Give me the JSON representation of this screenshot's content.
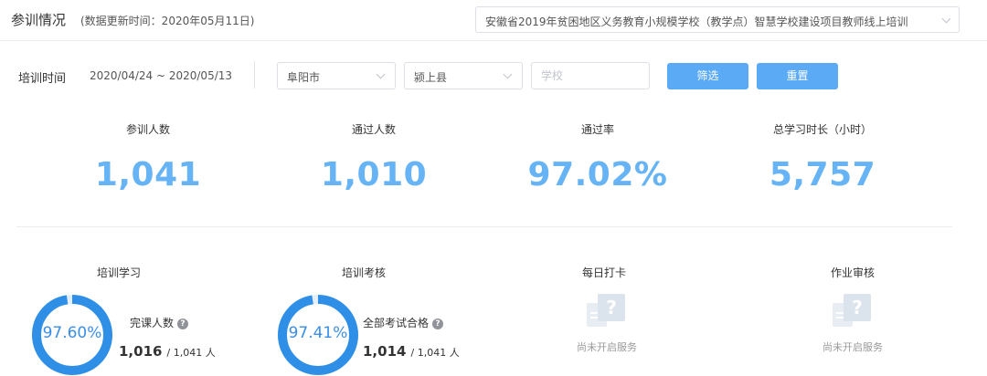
{
  "header": {
    "title": "参训情况",
    "update_info": "(数据更新时间：2020年05月11日)",
    "project": "安徽省2019年贫困地区义务教育小规模学校（教学点）智慧学校建设项目教师线上培训"
  },
  "filters": {
    "time_label": "培训时间",
    "date_range": "2020/04/24 ~ 2020/05/13",
    "city": "阜阳市",
    "county": "颍上县",
    "school_placeholder": "学校",
    "filter_button": "筛选",
    "reset_button": "重置"
  },
  "stats": [
    {
      "label": "参训人数",
      "value": "1,041"
    },
    {
      "label": "通过人数",
      "value": "1,010"
    },
    {
      "label": "通过率",
      "value": "97.02%"
    },
    {
      "label": "总学习时长（小时）",
      "value": "5,757"
    }
  ],
  "cards": {
    "study": {
      "title": "培训学习",
      "percent_text": "97.60%",
      "percent": 0.976,
      "metric_label": "完课人数",
      "count": "1,016",
      "total": "/ 1,041 人"
    },
    "exam": {
      "title": "培训考核",
      "percent_text": "97.41%",
      "percent": 0.9741,
      "metric_label": "全部考试合格",
      "count": "1,014",
      "total": "/ 1,041 人"
    },
    "checkin": {
      "title": "每日打卡",
      "status": "尚未开启服务"
    },
    "homework": {
      "title": "作业审核",
      "status": "尚未开启服务"
    }
  },
  "colors": {
    "accent": "#5aaaf5",
    "stat_value": "#66b4f5",
    "ring": "#2f8fe6"
  },
  "icons": {
    "help": "help-circle-icon",
    "dropdown": "chevron-down-icon",
    "service_off": "unknown-service-icon"
  }
}
